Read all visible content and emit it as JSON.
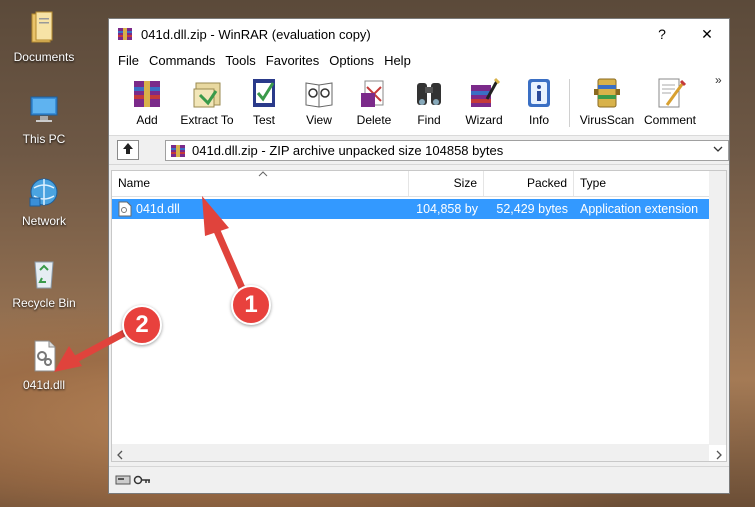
{
  "desktop": {
    "icons": [
      {
        "label": "Documents"
      },
      {
        "label": "This PC"
      },
      {
        "label": "Network"
      },
      {
        "label": "Recycle Bin"
      },
      {
        "label": "041d.dll"
      }
    ]
  },
  "window": {
    "title": "041d.dll.zip - WinRAR (evaluation copy)",
    "help_glyph": "?",
    "close_glyph": "✕"
  },
  "menu": [
    "File",
    "Commands",
    "Tools",
    "Favorites",
    "Options",
    "Help"
  ],
  "toolbar": {
    "tools": [
      "Add",
      "Extract To",
      "Test",
      "View",
      "Delete",
      "Find",
      "Wizard",
      "Info",
      "VirusScan",
      "Comment"
    ],
    "overflow": "»"
  },
  "address": {
    "text": "041d.dll.zip - ZIP archive unpacked size 104858 bytes"
  },
  "columns": [
    "Name",
    "Size",
    "Packed",
    "Type"
  ],
  "files": [
    {
      "name": "041d.dll",
      "size": "104,858 by",
      "packed": "52,429 bytes",
      "type": "Application extension"
    }
  ],
  "annotations": [
    "1",
    "2"
  ],
  "colors": {
    "selection": "#3399ff",
    "annotation_red": "#e8413d",
    "arrow_red": "#e0433c"
  }
}
